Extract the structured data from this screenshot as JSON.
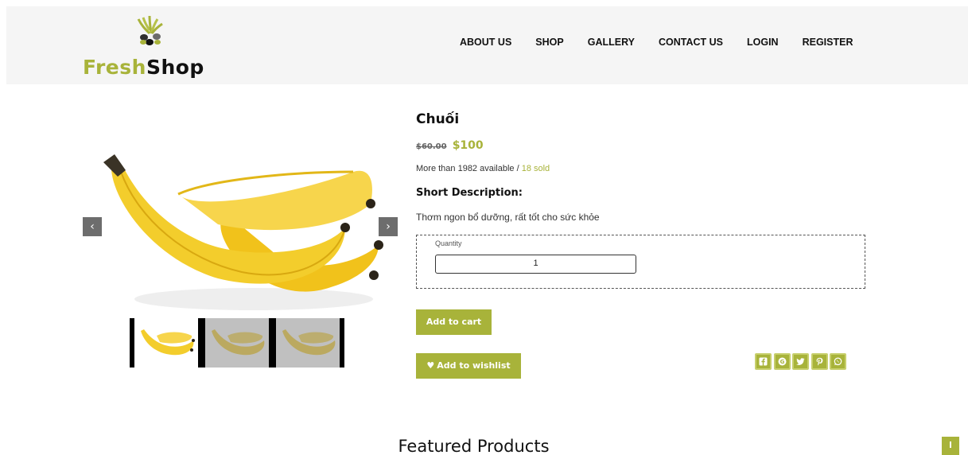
{
  "brand": {
    "part1": "Fresh",
    "part2": "Shop",
    "accent": "#a8b33a"
  },
  "nav": {
    "about": "ABOUT US",
    "shop": "SHOP",
    "gallery": "GALLERY",
    "contact": "CONTACT US",
    "login": "LOGIN",
    "register": "REGISTER"
  },
  "gallery": {
    "prev_icon": "chevron-left-icon",
    "next_icon": "chevron-right-icon",
    "prev_label": "‹",
    "next_label": "›",
    "thumbnail_count": 3,
    "active_thumbnail": 1
  },
  "product": {
    "title": "Chuối",
    "old_price": "$60.00",
    "price": "$100",
    "stock_text": "More than 1982 available / ",
    "sold_text": "18 sold",
    "description_title": "Short Description:",
    "description": "Thơm ngon bổ dưỡng, rất tốt cho sức khỏe"
  },
  "quantity": {
    "label": "Quantity",
    "value": "1"
  },
  "actions": {
    "add_to_cart": "Add to cart",
    "add_to_wishlist": "Add to wishlist"
  },
  "share": [
    "facebook-icon",
    "google-plus-icon",
    "twitter-icon",
    "pinterest-icon",
    "whatsapp-icon"
  ],
  "featured_title": "Featured Products"
}
